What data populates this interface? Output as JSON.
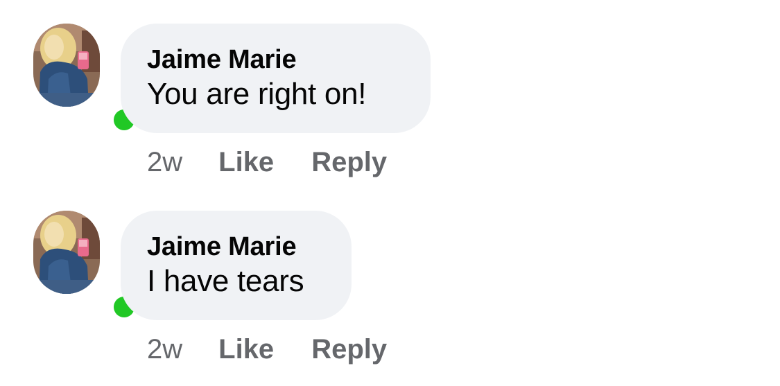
{
  "comments": [
    {
      "author": "Jaime Marie",
      "text": "You are right on!",
      "timestamp": "2w",
      "like_label": "Like",
      "reply_label": "Reply",
      "online": true
    },
    {
      "author": "Jaime Marie",
      "text": "I have tears",
      "timestamp": "2w",
      "like_label": "Like",
      "reply_label": "Reply",
      "online": true
    }
  ],
  "colors": {
    "bubble": "#f0f2f5",
    "secondary_text": "#65676b",
    "online": "#21c825"
  }
}
